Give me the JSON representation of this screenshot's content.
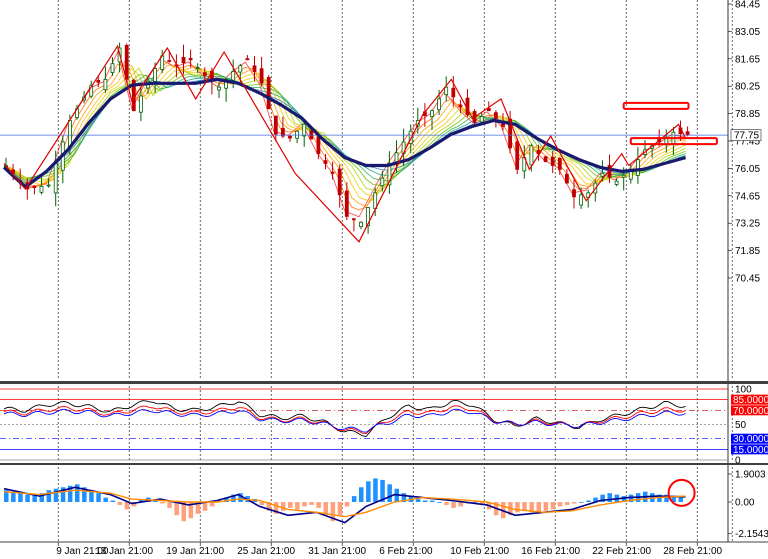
{
  "chart_data": [
    {
      "type": "candlestick",
      "panel": "price",
      "y_ticks": [
        84.45,
        83.05,
        81.65,
        80.25,
        78.85,
        77.45,
        76.05,
        74.65,
        73.25,
        71.85,
        70.45
      ],
      "ylim": [
        69.5,
        85.2
      ],
      "current_price_label": "77.75",
      "current_price": 77.75,
      "x_labels": [
        "9 Jan 21:00",
        "13 Jan 21:00",
        "19 Jan 21:00",
        "25 Jan 21:00",
        "31 Jan 21:00",
        "6 Feb 21:00",
        "10 Feb 21:00",
        "16 Feb 21:00",
        "22 Feb 21:00",
        "28 Feb 21:00"
      ],
      "x_label_positions": [
        2,
        12,
        22,
        32,
        42,
        52,
        62,
        72,
        82,
        92
      ],
      "bars_count": 105,
      "close_path": [
        [
          0,
          76.2
        ],
        [
          3,
          75.0
        ],
        [
          6,
          75.2
        ],
        [
          9,
          78.5
        ],
        [
          12,
          80.3
        ],
        [
          14,
          80.6
        ],
        [
          16,
          82.2
        ],
        [
          18,
          79.0
        ],
        [
          20,
          80.5
        ],
        [
          22,
          81.8
        ],
        [
          24,
          81.3
        ],
        [
          26,
          81.6
        ],
        [
          28,
          80.8
        ],
        [
          30,
          80.2
        ],
        [
          32,
          81.0
        ],
        [
          34,
          81.6
        ],
        [
          36,
          80.4
        ],
        [
          38,
          77.8
        ],
        [
          40,
          77.6
        ],
        [
          42,
          78.3
        ],
        [
          44,
          76.8
        ],
        [
          46,
          75.8
        ],
        [
          48,
          73.6
        ],
        [
          50,
          73.3
        ],
        [
          52,
          74.8
        ],
        [
          54,
          76.3
        ],
        [
          56,
          77.4
        ],
        [
          58,
          78.5
        ],
        [
          60,
          79.0
        ],
        [
          62,
          80.2
        ],
        [
          64,
          79.2
        ],
        [
          66,
          78.4
        ],
        [
          68,
          79.0
        ],
        [
          70,
          78.2
        ],
        [
          72,
          76.0
        ],
        [
          74,
          77.2
        ],
        [
          76,
          76.4
        ],
        [
          78,
          76.0
        ],
        [
          80,
          74.6
        ],
        [
          82,
          74.8
        ],
        [
          84,
          75.8
        ],
        [
          86,
          75.4
        ],
        [
          88,
          76.0
        ],
        [
          90,
          77.0
        ],
        [
          92,
          77.4
        ],
        [
          94,
          77.9
        ],
        [
          96,
          77.75
        ]
      ],
      "ma_thick": [
        [
          0,
          76.1
        ],
        [
          3,
          75.1
        ],
        [
          6,
          75.9
        ],
        [
          9,
          77.0
        ],
        [
          12,
          78.4
        ],
        [
          15,
          79.6
        ],
        [
          18,
          80.3
        ],
        [
          21,
          80.4
        ],
        [
          24,
          80.4
        ],
        [
          27,
          80.4
        ],
        [
          30,
          80.6
        ],
        [
          33,
          80.4
        ],
        [
          36,
          79.9
        ],
        [
          39,
          79.3
        ],
        [
          42,
          78.6
        ],
        [
          45,
          77.5
        ],
        [
          48,
          76.6
        ],
        [
          51,
          76.2
        ],
        [
          54,
          76.2
        ],
        [
          57,
          76.5
        ],
        [
          60,
          77.1
        ],
        [
          63,
          77.8
        ],
        [
          66,
          78.2
        ],
        [
          69,
          78.5
        ],
        [
          72,
          78.3
        ],
        [
          75,
          77.6
        ],
        [
          78,
          77.0
        ],
        [
          81,
          76.5
        ],
        [
          84,
          76.1
        ],
        [
          87,
          75.9
        ],
        [
          90,
          76.0
        ],
        [
          93,
          76.3
        ],
        [
          96,
          76.6
        ]
      ],
      "zigzag": [
        [
          0,
          76.3
        ],
        [
          3,
          75.0
        ],
        [
          16,
          82.3
        ],
        [
          18,
          79.5
        ],
        [
          23,
          82.2
        ],
        [
          27,
          79.6
        ],
        [
          31,
          82.0
        ],
        [
          41,
          75.8
        ],
        [
          50,
          72.3
        ],
        [
          59,
          78.8
        ],
        [
          63,
          80.6
        ],
        [
          66,
          78.6
        ],
        [
          70,
          79.6
        ],
        [
          74,
          76.0
        ],
        [
          77,
          77.7
        ],
        [
          82,
          74.4
        ],
        [
          87,
          76.8
        ],
        [
          88,
          76.2
        ],
        [
          95,
          78.3
        ],
        [
          96,
          77.6
        ]
      ],
      "annotation_rects": [
        {
          "bar_from": 87,
          "bar_to": 95,
          "price_top": 79.4,
          "price_bottom": 79.1,
          "color": "#ff0000"
        },
        {
          "bar_from": 88,
          "bar_to": 99,
          "price_top": 77.6,
          "price_bottom": 77.3,
          "color": "#ff0000"
        }
      ]
    },
    {
      "type": "line",
      "panel": "oscillator",
      "y_ticks": [
        "100",
        "85.0000",
        "70.0000",
        "50",
        "30.0000",
        "15.0000",
        "0"
      ],
      "levels": [
        100,
        85,
        70,
        50,
        30,
        15,
        0
      ],
      "level_boxes": [
        "85.0000",
        "70.0000",
        "30.0000",
        "15.0000"
      ],
      "series": [
        {
          "color": "#000000",
          "values": [
            [
              0,
              72
            ],
            [
              3,
              70
            ],
            [
              6,
              78
            ],
            [
              9,
              80
            ],
            [
              12,
              75
            ],
            [
              15,
              68
            ],
            [
              18,
              77
            ],
            [
              21,
              84
            ],
            [
              24,
              72
            ],
            [
              27,
              70
            ],
            [
              30,
              75
            ],
            [
              33,
              83
            ],
            [
              36,
              64
            ],
            [
              39,
              59
            ],
            [
              42,
              62
            ],
            [
              45,
              54
            ],
            [
              48,
              40
            ],
            [
              51,
              36
            ],
            [
              54,
              60
            ],
            [
              57,
              76
            ],
            [
              60,
              71
            ],
            [
              63,
              82
            ],
            [
              66,
              78
            ],
            [
              69,
              57
            ],
            [
              72,
              48
            ],
            [
              75,
              58
            ],
            [
              78,
              52
            ],
            [
              81,
              46
            ],
            [
              84,
              57
            ],
            [
              87,
              64
            ],
            [
              90,
              72
            ],
            [
              93,
              80
            ],
            [
              96,
              76
            ]
          ]
        },
        {
          "color": "#ff0000",
          "values": [
            [
              0,
              68
            ],
            [
              3,
              66
            ],
            [
              6,
              71
            ],
            [
              9,
              73
            ],
            [
              12,
              70
            ],
            [
              15,
              64
            ],
            [
              18,
              70
            ],
            [
              21,
              76
            ],
            [
              24,
              68
            ],
            [
              27,
              66
            ],
            [
              30,
              69
            ],
            [
              33,
              75
            ],
            [
              36,
              60
            ],
            [
              39,
              56
            ],
            [
              42,
              58
            ],
            [
              45,
              52
            ],
            [
              48,
              42
            ],
            [
              51,
              40
            ],
            [
              54,
              55
            ],
            [
              57,
              68
            ],
            [
              60,
              66
            ],
            [
              63,
              74
            ],
            [
              66,
              72
            ],
            [
              69,
              56
            ],
            [
              72,
              50
            ],
            [
              75,
              55
            ],
            [
              78,
              51
            ],
            [
              81,
              48
            ],
            [
              84,
              55
            ],
            [
              87,
              60
            ],
            [
              90,
              66
            ],
            [
              93,
              71
            ],
            [
              96,
              70
            ]
          ]
        },
        {
          "color": "#0000ff",
          "values": [
            [
              0,
              65
            ],
            [
              3,
              64
            ],
            [
              6,
              67
            ],
            [
              9,
              69
            ],
            [
              12,
              67
            ],
            [
              15,
              62
            ],
            [
              18,
              66
            ],
            [
              21,
              70
            ],
            [
              24,
              65
            ],
            [
              27,
              63
            ],
            [
              30,
              65
            ],
            [
              33,
              70
            ],
            [
              36,
              58
            ],
            [
              39,
              55
            ],
            [
              42,
              56
            ],
            [
              45,
              51
            ],
            [
              48,
              44
            ],
            [
              51,
              42
            ],
            [
              54,
              52
            ],
            [
              57,
              63
            ],
            [
              60,
              62
            ],
            [
              63,
              69
            ],
            [
              66,
              68
            ],
            [
              69,
              55
            ],
            [
              72,
              51
            ],
            [
              75,
              53
            ],
            [
              78,
              50
            ],
            [
              81,
              48
            ],
            [
              84,
              53
            ],
            [
              87,
              57
            ],
            [
              90,
              62
            ],
            [
              93,
              66
            ],
            [
              96,
              66
            ]
          ]
        }
      ]
    },
    {
      "type": "bar",
      "panel": "macd",
      "y_ticks": [
        "1.9003",
        "0.00",
        "-2.1543"
      ],
      "ylim": [
        -2.1543,
        1.9003
      ],
      "histogram": [
        0.8,
        0.7,
        0.6,
        0.5,
        0.5,
        0.6,
        0.8,
        0.9,
        1.0,
        1.1,
        1.2,
        1.0,
        0.8,
        0.6,
        0.3,
        0.1,
        -0.2,
        -0.5,
        -0.3,
        0.2,
        0.3,
        0.1,
        -0.1,
        -0.4,
        -0.9,
        -1.3,
        -1.1,
        -0.8,
        -0.6,
        -0.3,
        0.1,
        0.3,
        0.5,
        0.6,
        0.4,
        0.2,
        -0.2,
        -0.6,
        -0.8,
        -0.6,
        -0.4,
        -0.5,
        -0.3,
        -0.2,
        -0.4,
        -0.9,
        -1.3,
        -0.9,
        -0.3,
        0.4,
        1.0,
        1.4,
        1.6,
        1.5,
        1.2,
        0.9,
        0.6,
        0.4,
        0.2,
        0.1,
        0.1,
        0.0,
        -0.2,
        -0.4,
        -0.3,
        -0.1,
        0.0,
        -0.2,
        -0.5,
        -0.9,
        -1.1,
        -0.9,
        -0.7,
        -0.6,
        -0.7,
        -0.8,
        -0.6,
        -0.5,
        -0.3,
        -0.2,
        -0.1,
        0.0,
        0.1,
        0.3,
        0.5,
        0.6,
        0.5,
        0.4,
        0.5,
        0.6,
        0.7,
        0.6,
        0.5,
        0.5,
        0.4,
        0.3
      ],
      "macd_line": [
        [
          0,
          0.9
        ],
        [
          5,
          0.4
        ],
        [
          10,
          1.0
        ],
        [
          15,
          0.5
        ],
        [
          18,
          -0.1
        ],
        [
          22,
          0.2
        ],
        [
          26,
          -0.2
        ],
        [
          30,
          0.1
        ],
        [
          33,
          0.5
        ],
        [
          36,
          -0.3
        ],
        [
          40,
          -0.9
        ],
        [
          44,
          -0.7
        ],
        [
          48,
          -1.4
        ],
        [
          51,
          -0.3
        ],
        [
          55,
          0.5
        ],
        [
          59,
          0.3
        ],
        [
          63,
          0.1
        ],
        [
          68,
          -0.2
        ],
        [
          72,
          -0.9
        ],
        [
          76,
          -0.7
        ],
        [
          80,
          -0.5
        ],
        [
          84,
          0.1
        ],
        [
          88,
          0.3
        ],
        [
          92,
          0.4
        ],
        [
          96,
          0.35
        ]
      ],
      "signal_line": [
        [
          0,
          0.7
        ],
        [
          5,
          0.5
        ],
        [
          10,
          0.8
        ],
        [
          15,
          0.6
        ],
        [
          18,
          0.2
        ],
        [
          22,
          0.1
        ],
        [
          26,
          0.0
        ],
        [
          30,
          0.0
        ],
        [
          33,
          0.2
        ],
        [
          36,
          0.1
        ],
        [
          40,
          -0.5
        ],
        [
          44,
          -0.7
        ],
        [
          48,
          -1.0
        ],
        [
          51,
          -0.7
        ],
        [
          55,
          0.0
        ],
        [
          59,
          0.3
        ],
        [
          63,
          0.2
        ],
        [
          68,
          0.0
        ],
        [
          72,
          -0.5
        ],
        [
          76,
          -0.7
        ],
        [
          80,
          -0.6
        ],
        [
          84,
          -0.2
        ],
        [
          88,
          0.1
        ],
        [
          92,
          0.3
        ],
        [
          96,
          0.4
        ]
      ],
      "circle_marker": {
        "bar": 96,
        "value": 0.35,
        "color": "#ff0000"
      }
    }
  ],
  "colors": {
    "bull": "#006400",
    "bear": "#c00000",
    "ma_thick": "#191970",
    "zigzag": "#e00000",
    "price_line": "#4169e1",
    "hist_pos": "#1e90ff",
    "hist_neg": "#ffa07a",
    "macd": "#00008b",
    "signal": "#ff8c00",
    "level_red": "#ff0000",
    "level_blue": "#0000ff"
  }
}
